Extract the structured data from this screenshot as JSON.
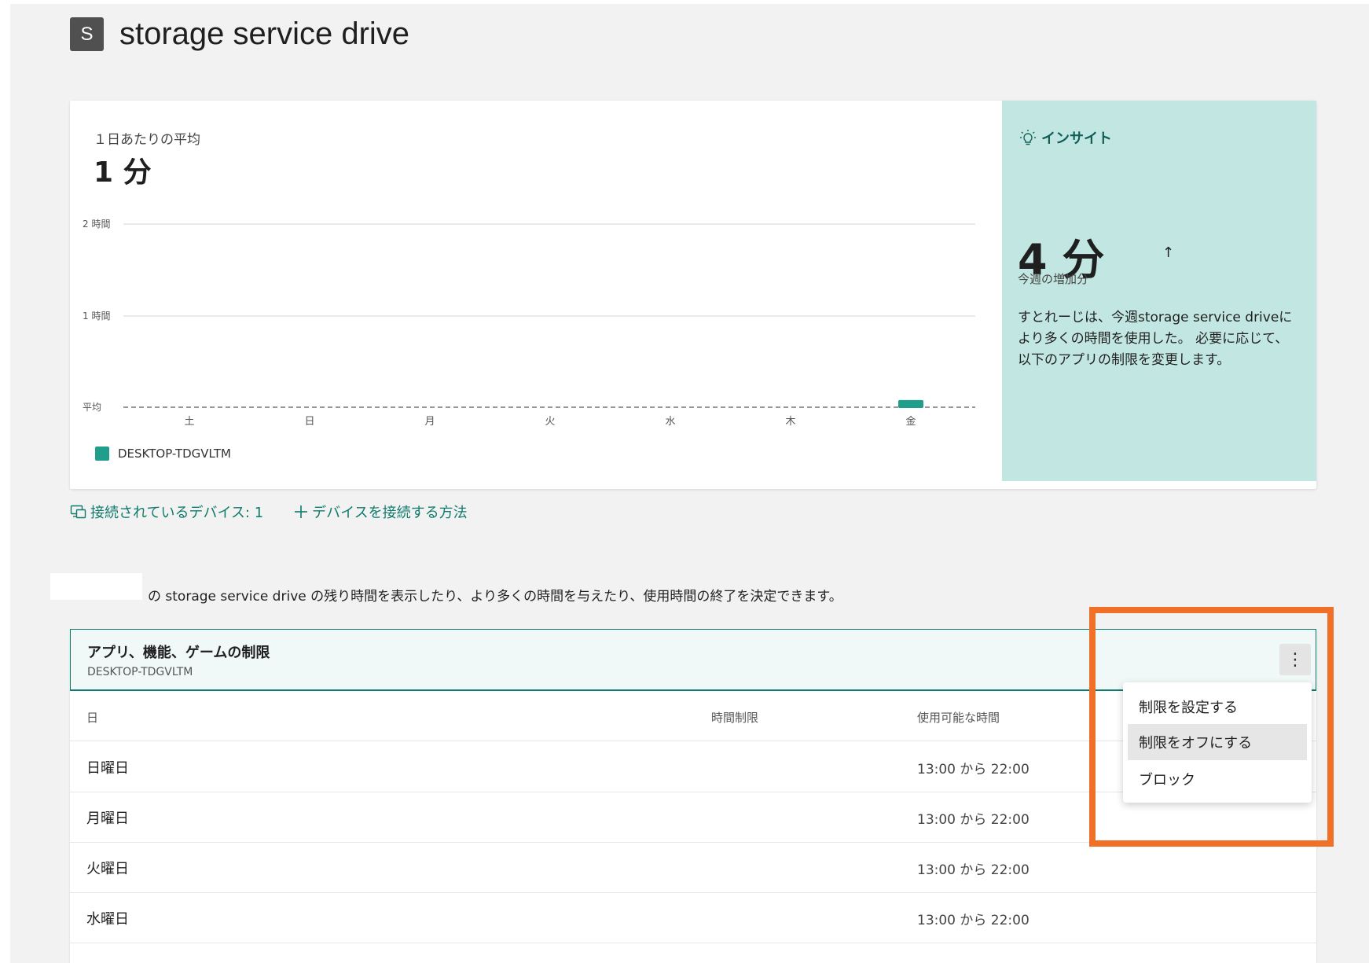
{
  "app": {
    "icon_letter": "S",
    "title": "storage service drive"
  },
  "summary": {
    "avg_label": "１日あたりの平均",
    "avg_value": "1 分"
  },
  "chart_data": {
    "type": "bar",
    "categories": [
      "土",
      "日",
      "月",
      "火",
      "水",
      "木",
      "金"
    ],
    "series": [
      {
        "name": "DESKTOP-TDGVLTM",
        "values": [
          0,
          0,
          0,
          0,
          0,
          0,
          4
        ]
      }
    ],
    "y_unit": "minutes",
    "ylim": [
      0,
      120
    ],
    "y_ticks": [
      {
        "label": "2 時間",
        "value": 120
      },
      {
        "label": "1 時間",
        "value": 60
      },
      {
        "label": "平均",
        "value": 1,
        "style": "dashed"
      }
    ],
    "grid": true,
    "legend_position": "bottom-left",
    "color": "#1f9e8c"
  },
  "insight": {
    "heading": "インサイト",
    "value": "4 分",
    "arrow": "↑",
    "sub": "今週の増加分",
    "text": "すとれーじは、今週storage service driveにより多くの時間を使用した。 必要に応じて、以下のアプリの制限を変更します。"
  },
  "links": {
    "devices": "接続されているデバイス: 1",
    "howto": "デバイスを接続する方法"
  },
  "description": "の storage service drive の残り時間を表示したり、より多くの時間を与えたり、使用時間の終了を決定できます。",
  "limits": {
    "title": "アプリ、機能、ゲームの制限",
    "subtitle": "DESKTOP-TDGVLTM",
    "more_icon": "⋮",
    "columns": {
      "day": "日",
      "limit": "時間制限",
      "available": "使用可能な時間"
    },
    "rows": [
      {
        "day": "日曜日",
        "limit": "",
        "available": "13:00 から 22:00"
      },
      {
        "day": "月曜日",
        "limit": "",
        "available": "13:00 から 22:00"
      },
      {
        "day": "火曜日",
        "limit": "",
        "available": "13:00 から 22:00"
      },
      {
        "day": "水曜日",
        "limit": "",
        "available": "13:00 から 22:00"
      }
    ]
  },
  "menu": {
    "items": [
      {
        "label": "制限を設定する",
        "active": false
      },
      {
        "label": "制限をオフにする",
        "active": true
      },
      {
        "label": "ブロック",
        "active": false
      }
    ]
  },
  "colors": {
    "accent": "#0f7b6c",
    "bar": "#1f9e8c",
    "insight_bg": "#c2e7e2",
    "highlight": "#f07028"
  }
}
